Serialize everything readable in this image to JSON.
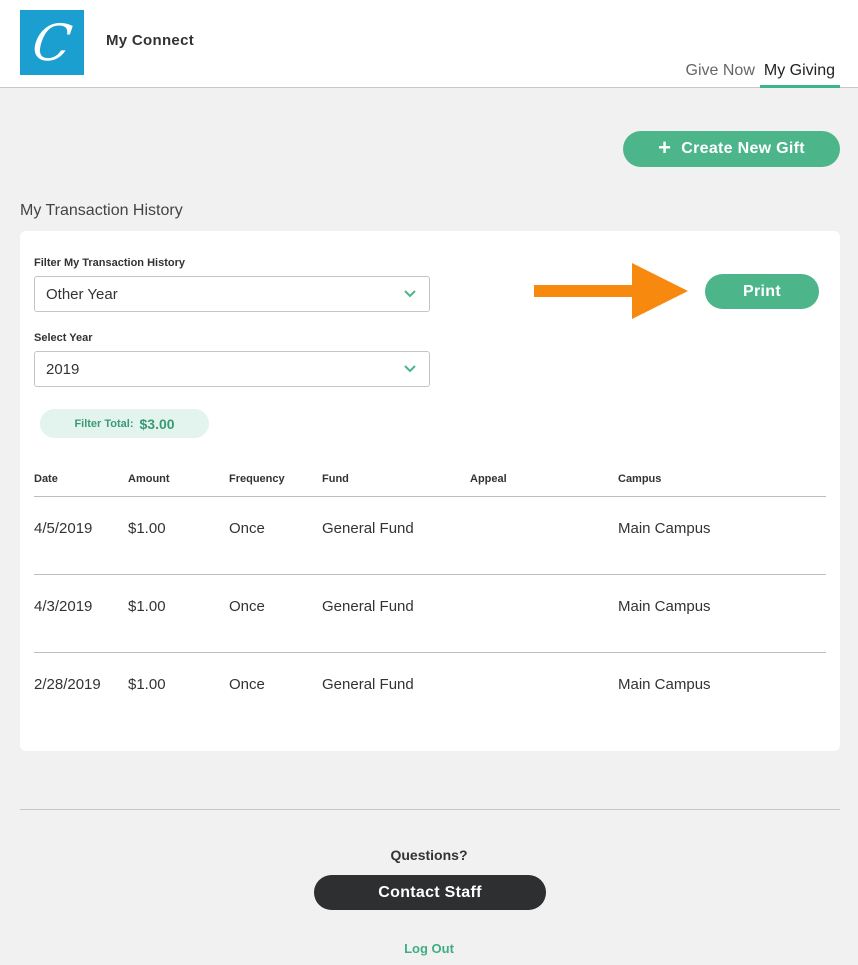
{
  "header": {
    "logo_letter": "C",
    "app_name": "My Connect",
    "nav": [
      {
        "label": "Give Now",
        "active": false
      },
      {
        "label": "My Giving",
        "active": true
      }
    ]
  },
  "actions": {
    "create_gift_label": "Create New Gift",
    "create_gift_icon": "plus-icon"
  },
  "history": {
    "title": "My Transaction History",
    "filter_label": "Filter My Transaction History",
    "filter_value": "Other Year",
    "year_label": "Select Year",
    "year_value": "2019",
    "print_label": "Print",
    "total_label": "Filter Total:",
    "total_value": "$3.00",
    "columns": [
      "Date",
      "Amount",
      "Frequency",
      "Fund",
      "Appeal",
      "Campus"
    ],
    "rows": [
      [
        "4/5/2019",
        "$1.00",
        "Once",
        "General Fund",
        "",
        "Main Campus"
      ],
      [
        "4/3/2019",
        "$1.00",
        "Once",
        "General Fund",
        "",
        "Main Campus"
      ],
      [
        "2/28/2019",
        "$1.00",
        "Once",
        "General Fund",
        "",
        "Main Campus"
      ]
    ]
  },
  "footer": {
    "questions": "Questions?",
    "contact_label": "Contact Staff",
    "logout_label": "Log Out"
  },
  "colors": {
    "brand_blue": "#1a9fd0",
    "accent_green": "#4cb58a",
    "arrow_orange": "#f7890f",
    "dark_button": "#2d2f31"
  }
}
